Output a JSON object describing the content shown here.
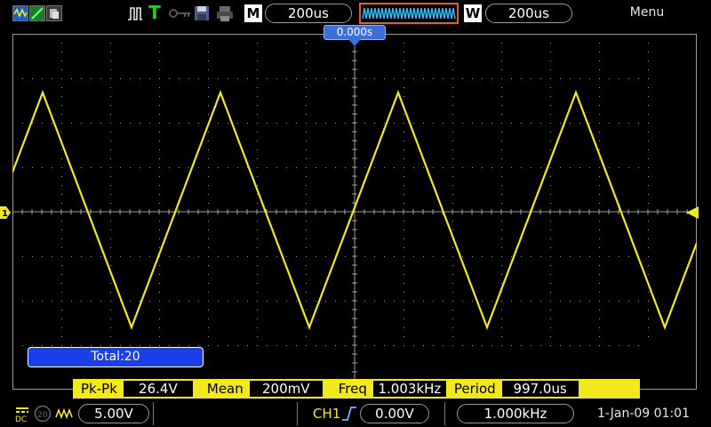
{
  "toolbar": {
    "icons": [
      "waveform-mode-icon",
      "dots-vectors-icon",
      "persistence-icon",
      "run-stop-icon",
      "trigger-icon",
      "usb-key-icon",
      "save-disk-icon",
      "printer-icon"
    ],
    "timebase_badge": "M",
    "timebase_value": "200us",
    "window_badge": "W",
    "window_value": "200us",
    "menu_label": "Menu"
  },
  "screen": {
    "trigger_position": "0.000s",
    "ch1_marker": "1",
    "total_label": "Total:20",
    "trace_color": "#f2e81e",
    "grid_color": "#9c9c9c"
  },
  "measurements": [
    {
      "label": "Pk-Pk",
      "value": "26.4V"
    },
    {
      "label": "Mean",
      "value": "200mV"
    },
    {
      "label": "Freq",
      "value": "1.003kHz"
    },
    {
      "label": "Period",
      "value": "997.0us"
    }
  ],
  "status": {
    "coupling_label": "DC",
    "bandwidth_label": "20",
    "volts_per_div": "5.00V",
    "trigger_source": "CH1",
    "trigger_level": "0.00V",
    "trigger_frequency": "1.000kHz",
    "datetime": "1-Jan-09 01:01"
  }
}
